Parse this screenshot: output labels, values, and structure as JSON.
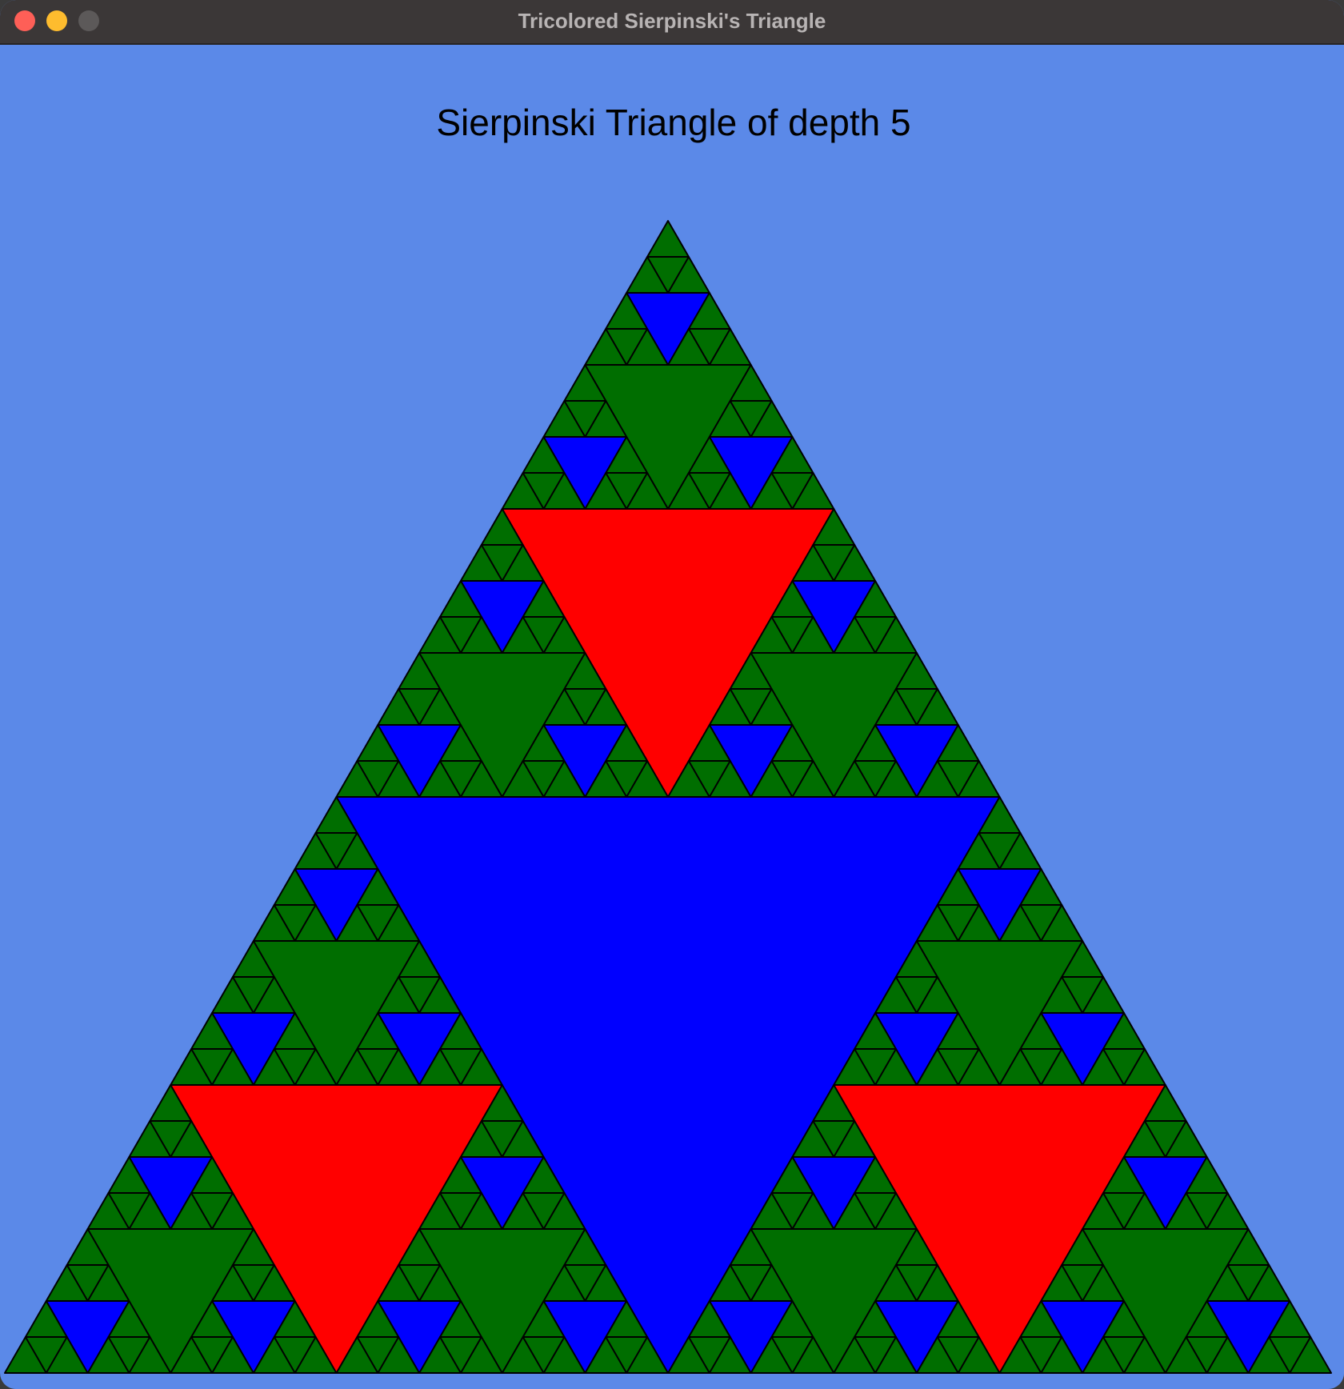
{
  "window": {
    "title": "Tricolored Sierpinski's Triangle"
  },
  "canvas": {
    "heading": "Sierpinski Triangle of depth 5",
    "depth": 5,
    "colors": {
      "background": "#5b89e8",
      "base_fill": "#006e00",
      "holes": [
        "#0000ff",
        "#ff0000",
        "#006e00",
        "#0000ff",
        "#006e00"
      ],
      "stroke": "#000000"
    }
  },
  "controls": {
    "close": "close-button",
    "minimize": "minimize-button",
    "zoom": "zoom-button"
  }
}
